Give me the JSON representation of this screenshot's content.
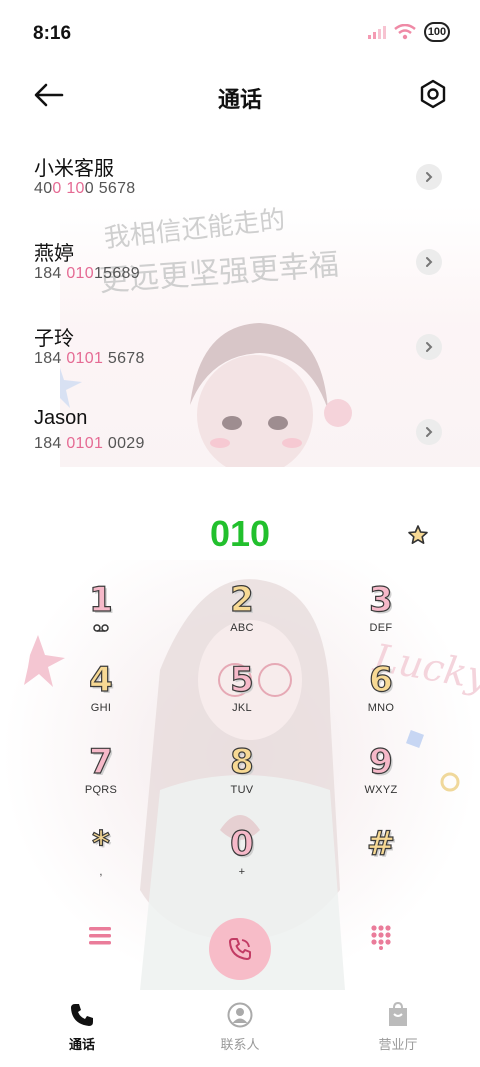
{
  "status_bar": {
    "time": "8:16",
    "battery": "100"
  },
  "header": {
    "title": "通话"
  },
  "contacts": [
    {
      "name": "小米客服",
      "number_parts": [
        "40",
        "0 10",
        "0 5678"
      ]
    },
    {
      "name": "燕婷",
      "number_parts": [
        "184 ",
        "010",
        "15689"
      ]
    },
    {
      "name": "子玲",
      "number_parts": [
        "184 ",
        "0101",
        " 5678"
      ]
    },
    {
      "name": "Jason",
      "number_parts": [
        "184 ",
        "0101",
        " 0029"
      ]
    }
  ],
  "background_text": {
    "line1": "我相信还能走的",
    "line2": "更远更坚强更幸福",
    "lucky": "Lucky"
  },
  "dialer": {
    "number": "010"
  },
  "keypad": [
    {
      "digit": "1",
      "letters": ""
    },
    {
      "digit": "2",
      "letters": "ABC"
    },
    {
      "digit": "3",
      "letters": "DEF"
    },
    {
      "digit": "4",
      "letters": "GHI"
    },
    {
      "digit": "5",
      "letters": "JKL"
    },
    {
      "digit": "6",
      "letters": "MNO"
    },
    {
      "digit": "7",
      "letters": "PQRS"
    },
    {
      "digit": "8",
      "letters": "TUV"
    },
    {
      "digit": "9",
      "letters": "WXYZ"
    },
    {
      "digit": "*",
      "letters": ","
    },
    {
      "digit": "0",
      "letters": "+"
    },
    {
      "digit": "#",
      "letters": ""
    }
  ],
  "tabs": [
    {
      "label": "通话",
      "icon": "phone-icon",
      "active": true
    },
    {
      "label": "联系人",
      "icon": "person-icon",
      "active": false
    },
    {
      "label": "营业厅",
      "icon": "bag-icon",
      "active": false
    }
  ],
  "colors": {
    "accent_green": "#22c02d",
    "highlight_pink": "#e56b94",
    "call_button": "#f7bcc8"
  }
}
